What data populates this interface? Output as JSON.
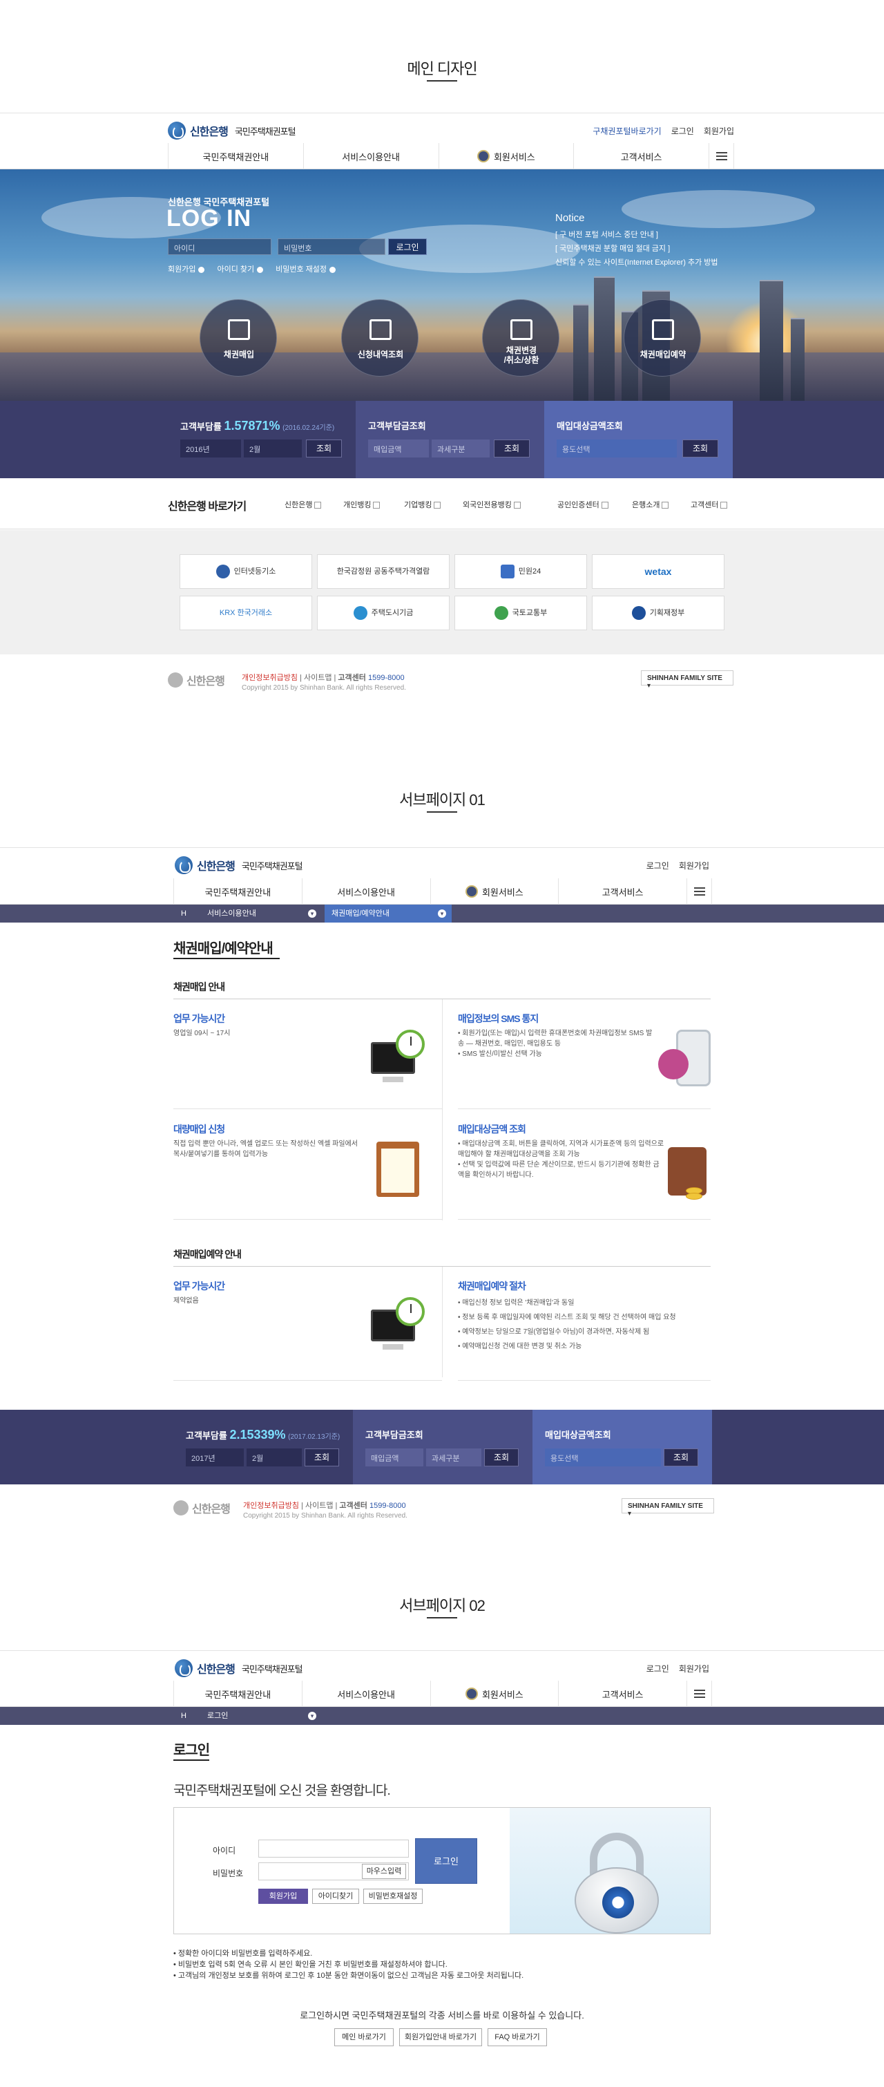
{
  "sections": {
    "main": "메인 디자인",
    "sub1": "서브페이지 01",
    "sub2": "서브페이지 02"
  },
  "header": {
    "brand": "신한은행",
    "portal": "국민주택채권포털",
    "util_main": [
      "구채권포털바로가기",
      "로그인",
      "회원가입"
    ],
    "util_sub": [
      "로그인",
      "회원가입"
    ]
  },
  "gnb": [
    "국민주택채권안내",
    "서비스이용안내",
    "회원서비스",
    "고객서비스"
  ],
  "hero": {
    "subtitle": "신한은행 국민주택채권포털",
    "title": "LOG IN",
    "id_placeholder": "아이디",
    "pw_placeholder": "비밀번호",
    "login_btn": "로그인",
    "links": [
      "회원가입",
      "아이디 찾기",
      "비밀번호 재설정"
    ],
    "notice_title": "Notice",
    "notices": [
      "[ 구 버전 포털 서비스 중단 안내 ]",
      "[ 국민주택채권 분할 매입 절대 금지 ]",
      "신뢰할 수 있는 사이트(Internet Explorer) 추가 방법"
    ],
    "circles": [
      {
        "icon": "purchase-icon",
        "label": "채권매입"
      },
      {
        "icon": "touch-icon",
        "label": "신청내역조회"
      },
      {
        "icon": "edit-icon",
        "label": "채권변경\n/취소/상환"
      },
      {
        "icon": "reserve-icon",
        "label": "채권매입예약"
      }
    ]
  },
  "band_main": {
    "rate_label": "고객부담률",
    "rate_value": "1.57871%",
    "rate_date": "(2016.02.24기준)",
    "year": "2016년",
    "month": "2월",
    "query": "조회",
    "fee_title": "고객부담금조회",
    "fee_amount": "매입금액",
    "fee_tax": "과세구분",
    "target_title": "매입대상금액조회",
    "target_select": "용도선택"
  },
  "band_sub": {
    "rate_value": "2.15339%",
    "rate_date": "(2017.02.13기준)",
    "year": "2017년",
    "month": "2월"
  },
  "quick": {
    "title": "신한은행 바로가기",
    "links": [
      "신한은행",
      "개인뱅킹",
      "기업뱅킹",
      "외국인전용뱅킹",
      "공인인증센터",
      "은행소개",
      "고객센터"
    ]
  },
  "banners": [
    "인터넷등기소",
    "한국감정원 공동주택가격열람",
    "민원24",
    "wetax",
    "KRX 한국거래소",
    "주택도시기금",
    "국토교통부",
    "기획재정부"
  ],
  "footer": {
    "privacy": "개인정보취급방침",
    "sitemap": "사이트맵",
    "center_label": "고객센터",
    "center_tel": "1599-8000",
    "copyright": "Copyright 2015 by Shinhan Bank. All rights Reserved.",
    "family": "SHINHAN FAMILY SITE"
  },
  "sub1": {
    "lnb_home": "H",
    "lnb_1": "서비스이용안내",
    "lnb_2": "채권매입/예약안내",
    "page_title": "채권매입/예약안내",
    "h3_a": "채권매입 안내",
    "h3_b": "채권매입예약 안내",
    "boxes": [
      {
        "title": "업무 가능시간",
        "desc": "영업일 09시 ~ 17시"
      },
      {
        "title": "매입정보의 SMS 통지",
        "desc": "• 회원가입(또는 매입)시 입력한 휴대폰번호에 차권매입정보 SMS 발송 — 채권번호, 매입민, 매입용도 등\n• SMS 발신/미발신 선택 가능"
      },
      {
        "title": "대량매입 신청",
        "desc": "직접 입력 뿐만 아니라, 엑셀 업로드 또는 작성하신 엑셀 파일에서 복사/붙여넣기를 통하여 입력가능"
      },
      {
        "title": "매입대상금액 조회",
        "desc": "• 매입대상금액 조회, 버튼을 클릭하여, 지역과 시가표준액 등의 입력으로 매입해야 할 채권매입대상금액을 조회 가능\n• 선택 및 입력값에 따른 단순 계산이므로, 반드시 등기기관에 정확한 금액을 확인하시기 바랍니다."
      },
      {
        "title": "업무 가능시간",
        "desc": "제약없음"
      },
      {
        "title": "채권매입예약 절차",
        "desc": "• 매입신청 정보 입력은 '채권매입'과 동일\n• 정보 등록 후 매입일자에 예약된 리스트 조회 및 해당 건 선택하여 매입 요청\n• 예약정보는 당일으로 7일(영업일수 아님)이 경과하면, 자동삭제 됨\n• 예약매입신청 건에 대한 변경 및 취소 가능"
      }
    ]
  },
  "sub2": {
    "lnb_home": "H",
    "lnb_1": "로그인",
    "page_title": "로그인",
    "welcome": "국민주택채권포털에 오신 것을 환영합니다.",
    "id_label": "아이디",
    "pw_label": "비밀번호",
    "mouse_input": "마우스입력",
    "login_btn": "로그인",
    "join": "회원가입",
    "find_id": "아이디찾기",
    "reset_pw": "비밀번호재설정",
    "notes": [
      "정확한 아이디와 비밀번호를 입력하주세요.",
      "비밀번호 입력 5회 연속 오류 시 본인 확인을 거친 후 비밀번호를 재설정하셔야 합니다.",
      "고객님의 개인정보 보호를 위하여 로그인 후 10분 동안 화면이동이 없으신 고객님은 자동 로그아웃 처리됩니다."
    ],
    "bottom_msg": "로그인하시면 국민주택채권포털의 각종 서비스를 바로 이용하실 수 있습니다.",
    "bottom_btns": [
      "메인 바로가기",
      "회원가입안내 바로가기",
      "FAQ 바로가기"
    ]
  }
}
